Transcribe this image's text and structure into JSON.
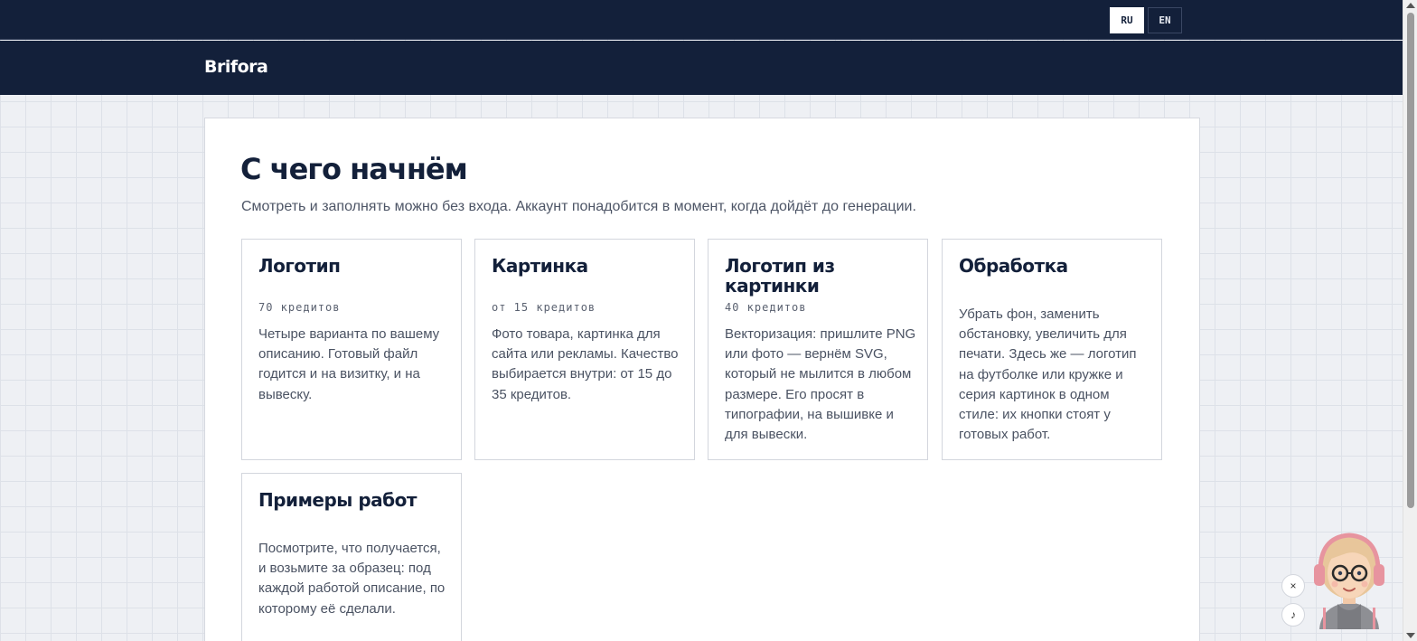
{
  "lang": {
    "ru": "RU",
    "en": "EN"
  },
  "header": {
    "brand": "Brifora"
  },
  "main": {
    "title": "С чего начнём",
    "subtitle": "Смотреть и заполнять можно без входа. Аккаунт понадобится в момент, когда дойдёт до генерации."
  },
  "cards": [
    {
      "title": "Логотип",
      "price": "70 кредитов",
      "desc": "Четыре варианта по вашему описанию. Готовый файл годится и на визитку, и на вывеску."
    },
    {
      "title": "Картинка",
      "price": "от 15 кредитов",
      "desc": "Фото товара, картинка для сайта или рекламы. Качество выбирается внутри: от 15 до 35 кредитов."
    },
    {
      "title": "Логотип из картинки",
      "price": "40 кредитов",
      "desc": "Векторизация: пришлите PNG или фото — вернём SVG, который не мылится в любом размере. Его просят в типографии, на вышивке и для вывески."
    },
    {
      "title": "Обработка",
      "price": "",
      "desc": "Убрать фон, заменить обстановку, увеличить для печати. Здесь же — логотип на футболке или кружке и серия картинок в одном стиле: их кнопки стоят у готовых работ."
    },
    {
      "title": "Примеры работ",
      "price": "",
      "desc": "Посмотрите, что получается, и возьмите за образец: под каждой работой описание, по которому её сделали."
    }
  ],
  "assistant": {
    "close": "×",
    "music": "♪"
  },
  "icons": {
    "close": "close-icon",
    "music": "music-note-icon",
    "avatar": "assistant-avatar"
  },
  "colors": {
    "navy": "#13203a",
    "background": "#eef0f4",
    "card": "#ffffff"
  }
}
